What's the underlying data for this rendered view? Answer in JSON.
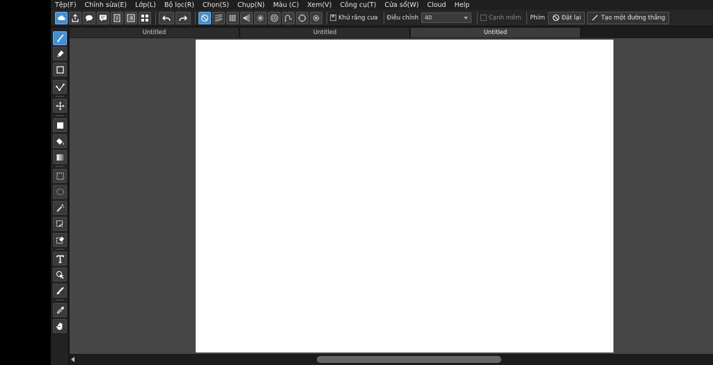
{
  "menu": [
    {
      "id": "file",
      "label": "Tệp(F)"
    },
    {
      "id": "edit",
      "label": "Chỉnh sửa(E)"
    },
    {
      "id": "layer",
      "label": "Lớp(L)"
    },
    {
      "id": "filter",
      "label": "Bộ lọc(R)"
    },
    {
      "id": "select",
      "label": "Chọn(S)"
    },
    {
      "id": "capture",
      "label": "Chụp(N)"
    },
    {
      "id": "color",
      "label": "Màu (C)"
    },
    {
      "id": "view",
      "label": "Xem(V)"
    },
    {
      "id": "tools",
      "label": "Công cụ(T)"
    },
    {
      "id": "window",
      "label": "Cửa sổ(W)"
    },
    {
      "id": "cloud",
      "label": "Cloud"
    },
    {
      "id": "help",
      "label": "Help"
    }
  ],
  "toolbar": {
    "antialias_label": "Khử răng cưa",
    "antialias_checked": true,
    "adjust_label": "Điều chỉnh",
    "adjust_value": "40",
    "soft_edge_label": "Cạnh mềm",
    "soft_edge_checked": false,
    "key_label": "Phím",
    "reset_label": "Đặt lại",
    "create_line_label": "Tạo một đường thẳng"
  },
  "tabs": [
    {
      "label": "Untitled",
      "active": false
    },
    {
      "label": "Untitled",
      "active": false
    },
    {
      "label": "Untitled",
      "active": true
    }
  ],
  "colors": {
    "accent": "#3d8fd8",
    "workspace": "#464646",
    "canvas": "#ffffff"
  }
}
